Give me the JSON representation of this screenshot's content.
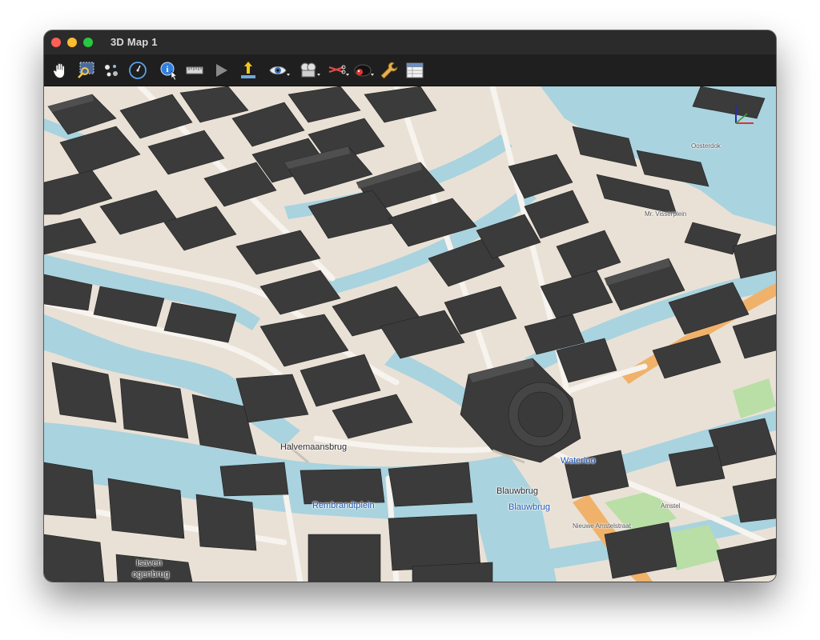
{
  "window": {
    "title": "3D Map 1"
  },
  "toolbar": {
    "tools": [
      {
        "name": "pan-hand-tool"
      },
      {
        "name": "zoom-region-tool"
      },
      {
        "name": "select-nodes-tool"
      },
      {
        "name": "rotate-view-tool"
      },
      {
        "name": "info-tool"
      },
      {
        "name": "measure-tool"
      },
      {
        "name": "play-animation-tool"
      },
      {
        "name": "vertical-exaggeration-tool"
      },
      {
        "name": "camera-view-tool"
      },
      {
        "name": "record-tool"
      },
      {
        "name": "clip-scissors-tool"
      },
      {
        "name": "light-source-tool"
      },
      {
        "name": "settings-wrench-tool"
      },
      {
        "name": "table-tool"
      }
    ]
  },
  "map": {
    "labels": {
      "halvemaansbrug": "Halvemaansbrug",
      "rembrandtplein": "Rembrandtplein",
      "blauwbrug": "Blauwbrug",
      "blauwbrug2": "Blauwbrug",
      "waterloo": "Waterloo",
      "isaven": "Isaven",
      "ogenbrug": "ogenbrug",
      "oosterdok": "Oosterdok",
      "wolfd": "Mr. Visserplein",
      "amstel": "Amstel",
      "nieuwe": "Nieuwe Amstelstraat"
    },
    "colors": {
      "water": "#a9d3df",
      "road": "#f7f3ee",
      "building": "#3b3b3b",
      "ground": "#e9e1d6",
      "park": "#b9dea6",
      "primary_road": "#f0b26a"
    }
  }
}
